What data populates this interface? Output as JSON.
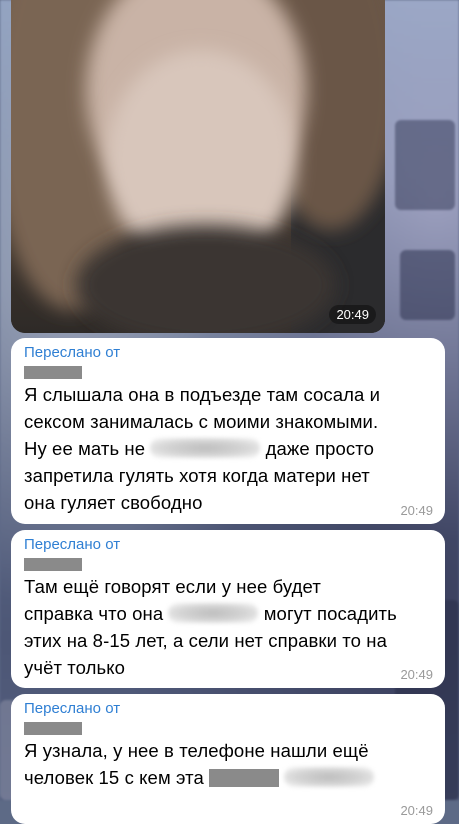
{
  "photo_message": {
    "time": "20:49"
  },
  "messages": [
    {
      "forwarded_label": "Переслано от",
      "lines": [
        "Я слышала она в подъезде там сосала и",
        "сексом занималась с моими знакомыми.",
        "Ну ее мать не",
        "даже просто",
        "запретила гулять хотя когда матери нет",
        "она гуляет свободно"
      ],
      "time": "20:49"
    },
    {
      "forwarded_label": "Переслано от",
      "lines": [
        "Там ещё говорят если у нее будет",
        "справка что она",
        "могут посадить",
        "этих на 8-15 лет, а сели нет справки то на",
        "учёт только"
      ],
      "time": "20:49"
    },
    {
      "forwarded_label": "Переслано от",
      "lines": [
        "Я узнала, у нее в телефоне нашли ещё",
        "человек 15 с кем эта"
      ],
      "time": "20:49"
    }
  ]
}
